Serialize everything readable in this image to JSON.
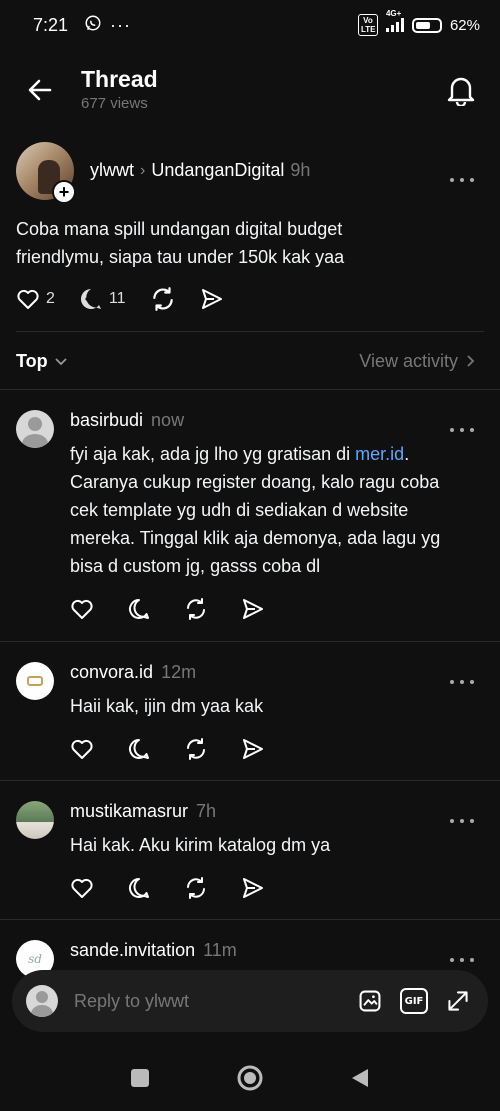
{
  "status_bar": {
    "time": "7:21",
    "network": "4G+",
    "volte": "Vo LTE",
    "battery_percent": "62%",
    "battery_level": 0.62
  },
  "header": {
    "title": "Thread",
    "views": "677 views"
  },
  "post": {
    "author": "ylwwt",
    "community": "UndanganDigital",
    "time": "9h",
    "text": "Coba mana spill undangan digital budget friendlymu, siapa tau under 150k kak yaa",
    "likes": "2",
    "replies": "11"
  },
  "sort": {
    "label": "Top",
    "view_activity": "View activity"
  },
  "comments": [
    {
      "user": "basirbudi",
      "time": "now",
      "text_before": "fyi aja kak, ada jg lho yg gratisan di ",
      "link": "mer.id",
      "text_after": ". Caranya cukup register doang, kalo ragu coba cek template yg udh di sediakan d website mereka. Tinggal klik aja demonya, ada lagu yg bisa d custom jg, gasss coba dl"
    },
    {
      "user": "convora.id",
      "time": "12m",
      "text": "Haii kak, ijin dm yaa kak"
    },
    {
      "user": "mustikamasrur",
      "time": "7h",
      "text": "Hai kak. Aku kirim katalog dm ya"
    },
    {
      "user": "sande.invitation",
      "time": "11m"
    }
  ],
  "reply_bar": {
    "placeholder": "Reply to ylwwt",
    "gif_label": "GIF"
  }
}
